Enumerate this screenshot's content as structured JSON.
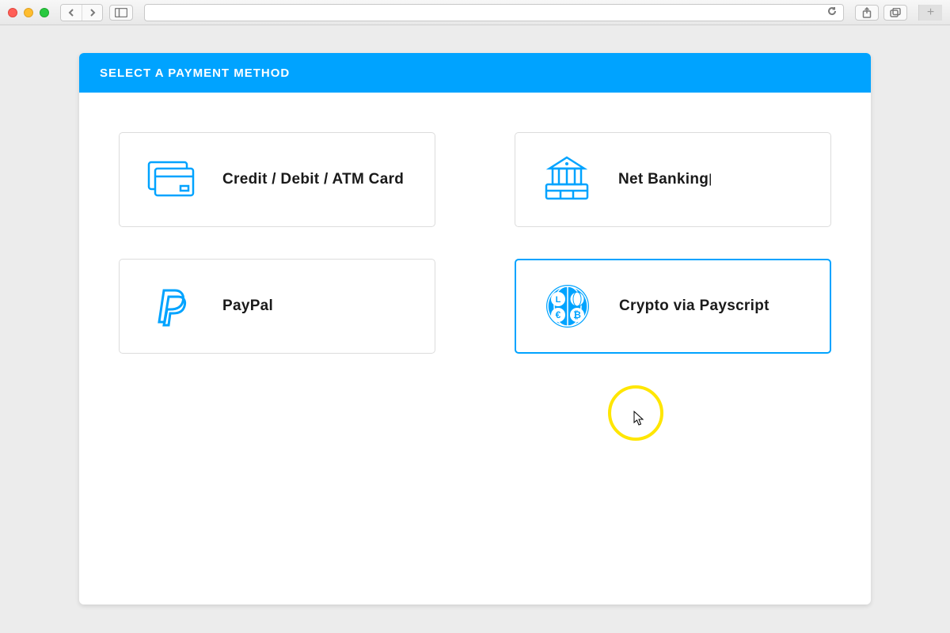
{
  "panel": {
    "title": "SELECT A PAYMENT METHOD"
  },
  "options": {
    "card": {
      "label": "Credit / Debit / ATM Card",
      "icon": "card-icon",
      "selected": false
    },
    "netbanking": {
      "label": "Net Banking",
      "icon": "bank-icon",
      "selected": false
    },
    "paypal": {
      "label": "PayPal",
      "icon": "paypal-icon",
      "selected": false
    },
    "crypto": {
      "label": "Crypto via Payscript",
      "icon": "crypto-icon",
      "selected": true
    }
  },
  "colors": {
    "accent": "#00a3ff",
    "highlight": "#ffe600"
  }
}
